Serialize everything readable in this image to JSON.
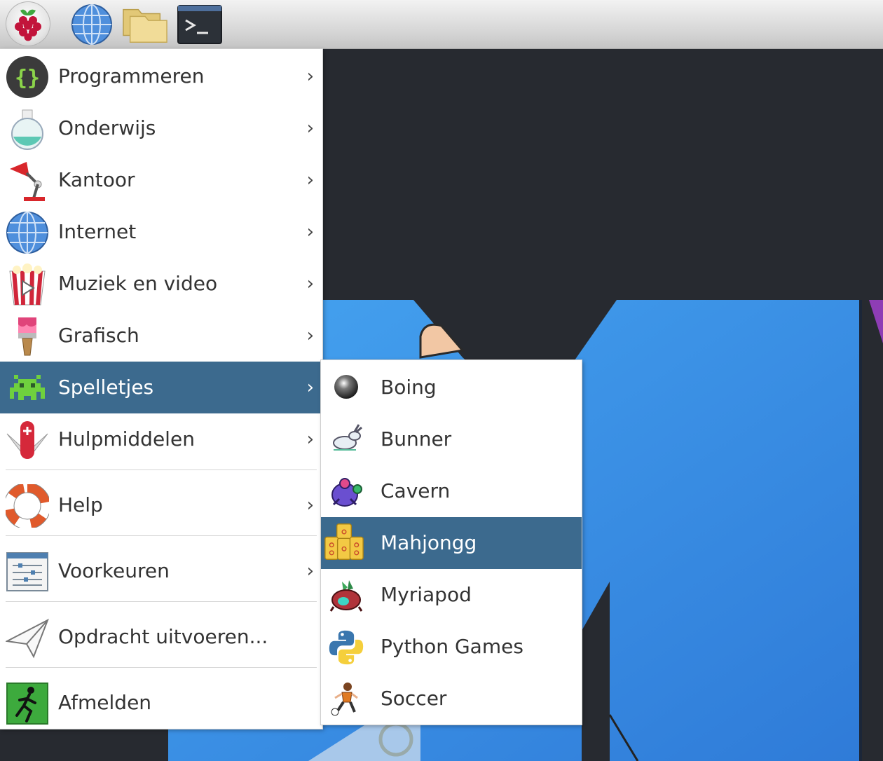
{
  "taskbar": {
    "buttons": [
      {
        "icon": "raspberry-icon"
      },
      {
        "icon": "globe-icon"
      },
      {
        "icon": "folder-icon"
      },
      {
        "icon": "terminal-icon"
      }
    ]
  },
  "main_menu": {
    "items": [
      {
        "label": "Programmeren",
        "icon": "programming-icon",
        "has_submenu": true
      },
      {
        "label": "Onderwijs",
        "icon": "flask-icon",
        "has_submenu": true
      },
      {
        "label": "Kantoor",
        "icon": "desk-lamp-icon",
        "has_submenu": true
      },
      {
        "label": "Internet",
        "icon": "globe-icon",
        "has_submenu": true
      },
      {
        "label": "Muziek en video",
        "icon": "popcorn-icon",
        "has_submenu": true
      },
      {
        "label": "Grafisch",
        "icon": "paintbrush-icon",
        "has_submenu": true
      },
      {
        "label": "Spelletjes",
        "icon": "space-invader-icon",
        "has_submenu": true,
        "active": true
      },
      {
        "label": "Hulpmiddelen",
        "icon": "swiss-knife-icon",
        "has_submenu": true
      },
      {
        "label": "Help",
        "icon": "lifebuoy-icon",
        "has_submenu": true
      },
      {
        "label": "Voorkeuren",
        "icon": "sliders-icon",
        "has_submenu": true
      },
      {
        "label": "Opdracht uitvoeren...",
        "icon": "paper-plane-icon",
        "has_submenu": false
      },
      {
        "label": "Afmelden",
        "icon": "exit-runner-icon",
        "has_submenu": false
      }
    ],
    "chevron": "›"
  },
  "games_menu": {
    "items": [
      {
        "label": "Boing",
        "icon": "ball-icon"
      },
      {
        "label": "Bunner",
        "icon": "rabbit-icon"
      },
      {
        "label": "Cavern",
        "icon": "robot-icon"
      },
      {
        "label": "Mahjongg",
        "icon": "mahjongg-tiles-icon",
        "active": true
      },
      {
        "label": "Myriapod",
        "icon": "myriapod-icon"
      },
      {
        "label": "Python Games",
        "icon": "python-icon"
      },
      {
        "label": "Soccer",
        "icon": "soccer-player-icon"
      }
    ]
  },
  "colors": {
    "highlight": "#3c6a8e",
    "desktop": "#272a30",
    "wallpaper_blue": "#3d8fe0"
  }
}
